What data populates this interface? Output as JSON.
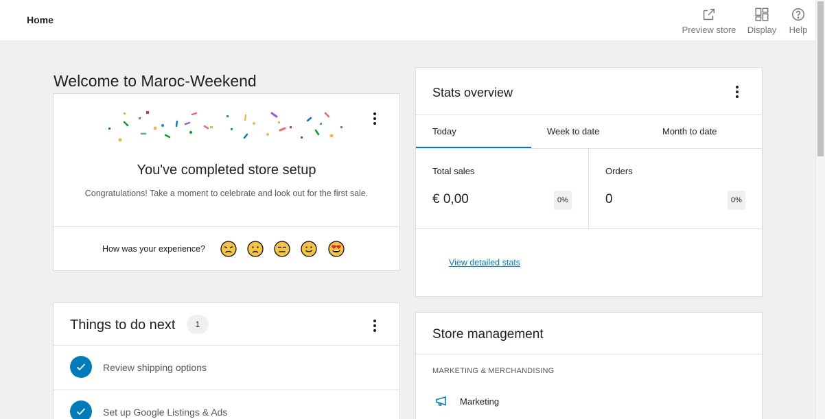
{
  "header": {
    "title": "Home",
    "actions": [
      {
        "label": "Preview store",
        "icon": "external-link-icon"
      },
      {
        "label": "Display",
        "icon": "layout-grid-icon"
      },
      {
        "label": "Help",
        "icon": "help-circle-icon"
      }
    ]
  },
  "welcome": {
    "heading": "Welcome to Maroc-Weekend"
  },
  "celebration": {
    "title": "You've completed store setup",
    "subtitle": "Congratulations! Take a moment to celebrate and look out for the first sale.",
    "feedback_label": "How was your experience?",
    "emojis": [
      "very-dissatisfied-emoji",
      "dissatisfied-emoji",
      "neutral-emoji",
      "satisfied-emoji",
      "very-satisfied-emoji"
    ]
  },
  "todo": {
    "title": "Things to do next",
    "count": "1",
    "tasks": [
      {
        "label": "Review shipping options",
        "done": true
      },
      {
        "label": "Set up Google Listings & Ads",
        "done": true
      }
    ]
  },
  "stats": {
    "title": "Stats overview",
    "tabs": [
      "Today",
      "Week to date",
      "Month to date"
    ],
    "active_tab": "Today",
    "metrics": [
      {
        "label": "Total sales",
        "value": "€ 0,00",
        "delta": "0%"
      },
      {
        "label": "Orders",
        "value": "0",
        "delta": "0%"
      }
    ],
    "link": "View detailed stats"
  },
  "management": {
    "title": "Store management",
    "section": "MARKETING & MERCHANDISING",
    "items": [
      {
        "label": "Marketing",
        "icon": "megaphone-icon"
      }
    ]
  },
  "colors": {
    "accent": "#007cba",
    "background": "#f0f0f0",
    "card": "#ffffff"
  }
}
